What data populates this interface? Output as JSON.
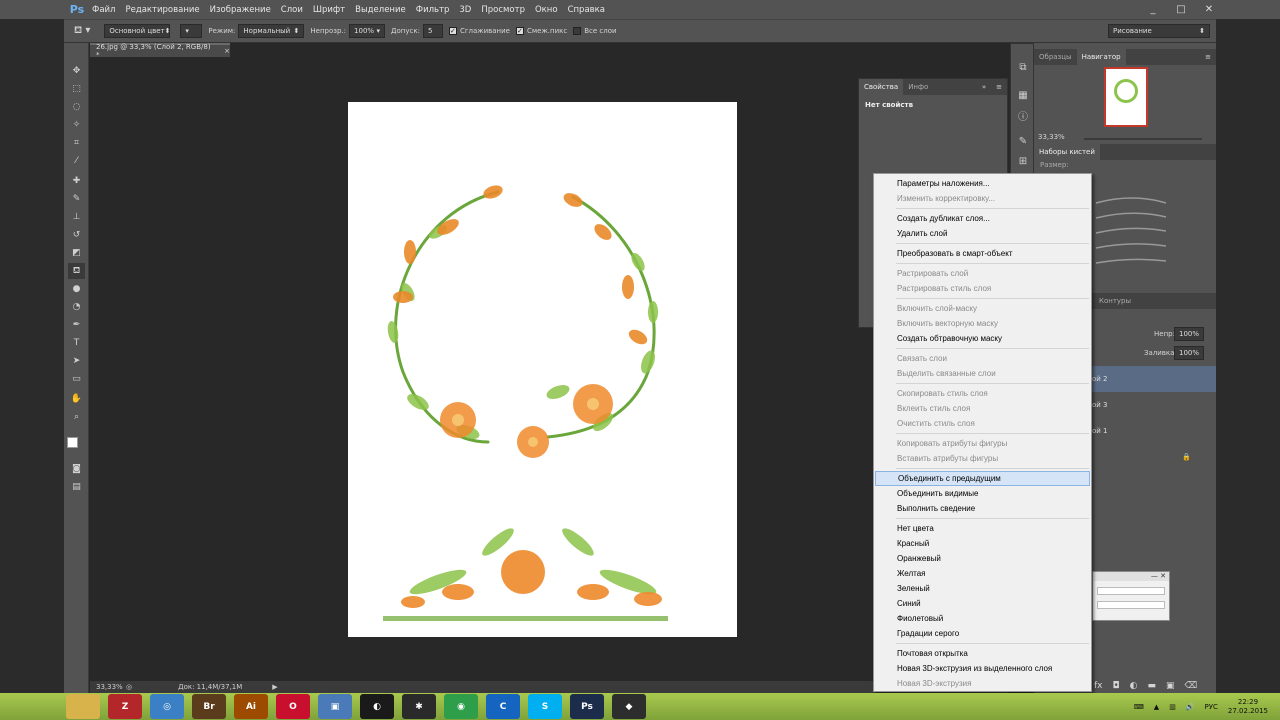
{
  "app": {
    "logo": "Ps"
  },
  "menu": [
    "Файл",
    "Редактирование",
    "Изображение",
    "Слои",
    "Шрифт",
    "Выделение",
    "Фильтр",
    "3D",
    "Просмотр",
    "Окно",
    "Справка"
  ],
  "window_controls": [
    "_",
    "□",
    "✕"
  ],
  "options": {
    "tool_preset": "Основной цвет",
    "mode_label": "Режим:",
    "mode_value": "Нормальный",
    "opacity_label": "Непрозр.:",
    "opacity_value": "100%",
    "tolerance_label": "Допуск:",
    "tolerance_value": "5",
    "antialias": "Сглаживание",
    "contiguous": "Смеж.пикс",
    "all_layers": "Все слои",
    "workspace": "Рисование"
  },
  "document": {
    "tab_title": "26.jpg @ 33,3% (Слой 2, RGB/8) *",
    "tab_close": "×",
    "status_zoom": "33,33%",
    "status_doc": "Док: 11,4M/37,1M"
  },
  "properties": {
    "tab_active": "Свойства",
    "tab_inactive": "Инфо",
    "no_props": "Нет свойств"
  },
  "right": {
    "tab_swatches": "Образцы",
    "tab_navigator": "Навигатор",
    "nav_zoom": "33,33%",
    "brushes_tab": "Наборы кистей",
    "brush_size_label": "Размер:",
    "paths_tab": "Контуры",
    "layers_opacity_label": "Непр:",
    "layers_opacity": "100%",
    "fill_label": "Заливка:",
    "fill_value": "100%",
    "layers": [
      "ой 2",
      "ой 3",
      "ой 1"
    ]
  },
  "context_menu": {
    "items": [
      {
        "label": "Параметры наложения...",
        "enabled": true
      },
      {
        "label": "Изменить корректировку...",
        "enabled": false
      },
      {
        "sep": true
      },
      {
        "label": "Создать дубликат слоя...",
        "enabled": true
      },
      {
        "label": "Удалить слой",
        "enabled": true
      },
      {
        "sep": true
      },
      {
        "label": "Преобразовать в смарт-объект",
        "enabled": true
      },
      {
        "sep": true
      },
      {
        "label": "Растрировать слой",
        "enabled": false
      },
      {
        "label": "Растрировать стиль слоя",
        "enabled": false
      },
      {
        "sep": true
      },
      {
        "label": "Включить слой-маску",
        "enabled": false
      },
      {
        "label": "Включить векторную маску",
        "enabled": false
      },
      {
        "label": "Создать обтравочную маску",
        "enabled": true
      },
      {
        "sep": true
      },
      {
        "label": "Связать слои",
        "enabled": false
      },
      {
        "label": "Выделить связанные слои",
        "enabled": false
      },
      {
        "sep": true
      },
      {
        "label": "Скопировать стиль слоя",
        "enabled": false
      },
      {
        "label": "Вклеить стиль слоя",
        "enabled": false
      },
      {
        "label": "Очистить стиль слоя",
        "enabled": false
      },
      {
        "sep": true
      },
      {
        "label": "Копировать атрибуты фигуры",
        "enabled": false
      },
      {
        "label": "Вставить атрибуты фигуры",
        "enabled": false
      },
      {
        "sep": true
      },
      {
        "label": "Объединить с предыдущим",
        "enabled": true,
        "highlighted": true
      },
      {
        "label": "Объединить видимые",
        "enabled": true
      },
      {
        "label": "Выполнить сведение",
        "enabled": true
      },
      {
        "sep": true
      },
      {
        "label": "Нет цвета",
        "enabled": true
      },
      {
        "label": "Красный",
        "enabled": true
      },
      {
        "label": "Оранжевый",
        "enabled": true
      },
      {
        "label": "Желтая",
        "enabled": true
      },
      {
        "label": "Зеленый",
        "enabled": true
      },
      {
        "label": "Синий",
        "enabled": true
      },
      {
        "label": "Фиолетовый",
        "enabled": true
      },
      {
        "label": "Градации серого",
        "enabled": true
      },
      {
        "sep": true
      },
      {
        "label": "Почтовая открытка",
        "enabled": true
      },
      {
        "label": "Новая 3D-экструзия из выделенного слоя",
        "enabled": true
      },
      {
        "label": "Новая 3D-экструзия",
        "enabled": false
      }
    ]
  },
  "taskbar": {
    "apps": [
      {
        "name": "explorer",
        "glyph": "",
        "color": "#d8b24a"
      },
      {
        "name": "filezilla",
        "glyph": "Z",
        "color": "#b3262a"
      },
      {
        "name": "app-blue",
        "glyph": "◎",
        "color": "#3b7fc4"
      },
      {
        "name": "bridge",
        "glyph": "Br",
        "color": "#5a3c1c"
      },
      {
        "name": "illustrator",
        "glyph": "Ai",
        "color": "#9c4b00"
      },
      {
        "name": "opera",
        "glyph": "O",
        "color": "#c8102e"
      },
      {
        "name": "viewer",
        "glyph": "▣",
        "color": "#4a7ab8"
      },
      {
        "name": "app-dark",
        "glyph": "◐",
        "color": "#1a1a1a"
      },
      {
        "name": "app-red",
        "glyph": "✱",
        "color": "#2a2a2a"
      },
      {
        "name": "chrome",
        "glyph": "◉",
        "color": "#2e9e4a"
      },
      {
        "name": "ccleaner",
        "glyph": "C",
        "color": "#1565c0"
      },
      {
        "name": "skype",
        "glyph": "S",
        "color": "#00aff0"
      },
      {
        "name": "photoshop",
        "glyph": "Ps",
        "color": "#1c2d4c"
      },
      {
        "name": "app-misc",
        "glyph": "◆",
        "color": "#2d2d2d"
      }
    ],
    "lang": "РУС",
    "time": "22:29",
    "date": "27.02.2015"
  },
  "colors": {
    "accent": "#6db3f2",
    "panel": "#535353",
    "dark": "#282828",
    "menu_hl": "#d5e5f7"
  }
}
